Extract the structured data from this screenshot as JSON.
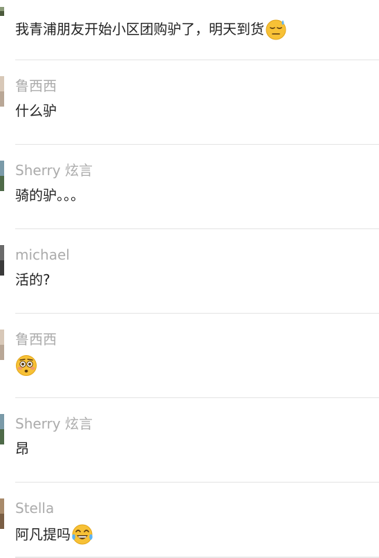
{
  "comments": [
    {
      "author": "",
      "text": "我青浦朋友开始小区团购驴了，明天到货",
      "emoji": "downcast-sweat-emoji"
    },
    {
      "author": "鲁西西",
      "text": "什么驴",
      "emoji": ""
    },
    {
      "author": "Sherry 炫言",
      "text": "骑的驴。。。",
      "emoji": ""
    },
    {
      "author": "michael",
      "text": "活的?",
      "emoji": ""
    },
    {
      "author": "鲁西西",
      "text": "",
      "emoji": "flushed-emoji"
    },
    {
      "author": "Sherry 炫言",
      "text": "昂",
      "emoji": ""
    },
    {
      "author": "Stella",
      "text": "阿凡提吗",
      "emoji": "tears-of-joy-emoji"
    }
  ],
  "colors": {
    "author": "#ababab",
    "text": "#222222",
    "divider": "#e3e3e3",
    "background": "#ffffff"
  }
}
